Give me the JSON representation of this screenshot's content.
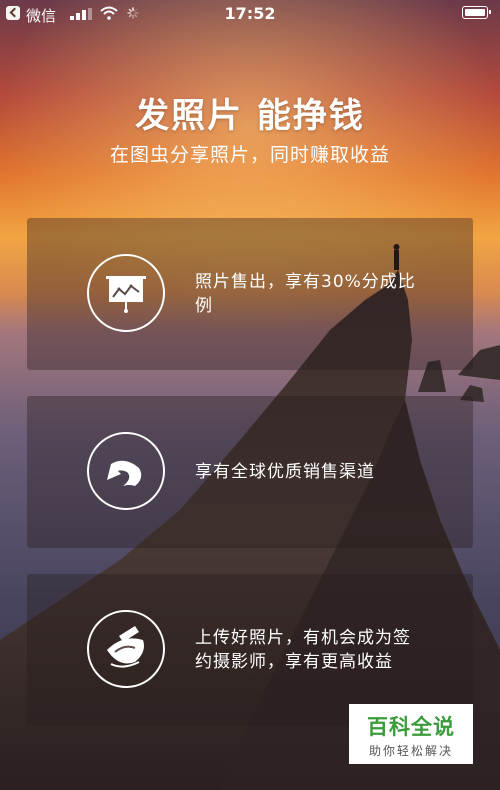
{
  "status_bar": {
    "carrier": "微信",
    "time": "17:52"
  },
  "header": {
    "title": "发照片 能挣钱",
    "subtitle": "在图虫分享照片，同时赚取收益"
  },
  "features": [
    {
      "icon": "presentation-chart-icon",
      "text": "照片售出，享有30%分成比例"
    },
    {
      "icon": "share-arrow-icon",
      "text": "享有全球优质销售渠道"
    },
    {
      "icon": "signature-pen-icon",
      "text": "上传好照片，有机会成为签约摄影师，享有更高收益"
    }
  ],
  "watermark": {
    "title": "百科全说",
    "subtitle": "助你轻松解决"
  }
}
